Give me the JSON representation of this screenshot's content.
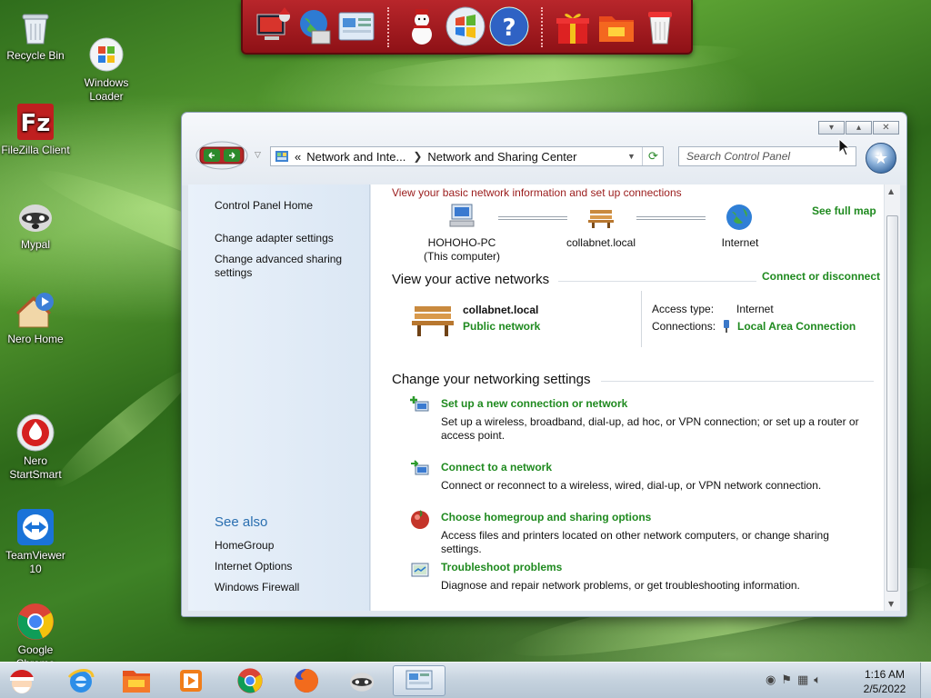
{
  "desktop": {
    "icons": [
      {
        "label": "Recycle Bin",
        "icon": "recycle-bin-icon"
      },
      {
        "label": "Windows\nLoader",
        "icon": "windows-loader-icon"
      },
      {
        "label": "FileZilla Client",
        "icon": "filezilla-icon"
      },
      {
        "label": "Mypal",
        "icon": "mypal-icon"
      },
      {
        "label": "Nero Home",
        "icon": "nero-home-icon"
      },
      {
        "label": "Nero\nStartSmart",
        "icon": "nero-startsmart-icon"
      },
      {
        "label": "TeamViewer\n10",
        "icon": "teamviewer-icon"
      },
      {
        "label": "Google\nChrome",
        "icon": "chrome-icon"
      }
    ]
  },
  "dock": {
    "items": [
      "computer-icon",
      "network-globe-icon",
      "control-panel-icon",
      "snowman-icon",
      "windows-orb-icon",
      "help-icon",
      "gift-icon",
      "folder-icon",
      "recycle-bin-icon"
    ]
  },
  "window": {
    "address": {
      "overflow": "«",
      "crumb1": "Network and Inte...",
      "crumb2": "Network and Sharing Center"
    },
    "search_placeholder": "Search Control Panel",
    "controls": {
      "minimize": "▾",
      "maximize": "▴",
      "close": "✕"
    }
  },
  "left_pane": {
    "home": "Control Panel Home",
    "links": [
      "Change adapter settings",
      "Change advanced sharing settings"
    ],
    "see_also_title": "See also",
    "see_also": [
      "HomeGroup",
      "Internet Options",
      "Windows Firewall"
    ]
  },
  "main": {
    "header": "View your basic network information and set up connections",
    "see_full_map": "See full map",
    "map": {
      "computer_name": "HOHOHO-PC",
      "computer_sub": "(This computer)",
      "network_name": "collabnet.local",
      "internet": "Internet"
    },
    "active_title": "View your active networks",
    "connect_link": "Connect or disconnect",
    "active": {
      "name": "collabnet.local",
      "type": "Public network",
      "access_label": "Access type:",
      "access_value": "Internet",
      "conn_label": "Connections:",
      "conn_value": "Local Area Connection"
    },
    "change_title": "Change your networking settings",
    "tasks": [
      {
        "title": "Set up a new connection or network",
        "desc": "Set up a wireless, broadband, dial-up, ad hoc, or VPN connection; or set up a router or access point."
      },
      {
        "title": "Connect to a network",
        "desc": "Connect or reconnect to a wireless, wired, dial-up, or VPN network connection."
      },
      {
        "title": "Choose homegroup and sharing options",
        "desc": "Access files and printers located on other network computers, or change sharing settings."
      },
      {
        "title": "Troubleshoot problems",
        "desc": "Diagnose and repair network problems, or get troubleshooting information."
      }
    ]
  },
  "taskbar": {
    "time": "1:16 AM",
    "date": "2/5/2022",
    "items": [
      "santa-start-icon",
      "internet-explorer-icon",
      "file-explorer-icon",
      "media-player-icon",
      "chrome-icon",
      "firefox-icon",
      "mypal-icon",
      "control-panel-icon"
    ]
  }
}
